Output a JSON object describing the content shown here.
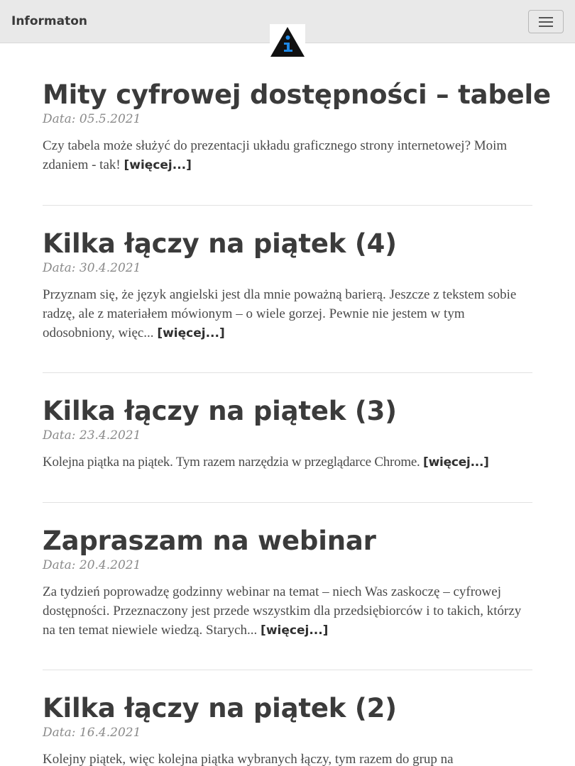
{
  "navbar": {
    "brand": "Informaton",
    "logo_icon": "info-triangle-logo",
    "menu_icon": "hamburger-menu-icon",
    "colors": {
      "background": "#e9e9e9",
      "logo_triangle": "#111111",
      "logo_i": "#1e88e5"
    }
  },
  "posts": [
    {
      "title": "Mity cyfrowej dostępności – tabele",
      "date_label": "Data:",
      "date": "05.5.2021",
      "excerpt": "Czy tabela może służyć do prezentacji układu graficznego strony internetowej? Moim zdaniem - tak!",
      "more": "[więcej...]"
    },
    {
      "title": "Kilka łączy na piątek (4)",
      "date_label": "Data:",
      "date": "30.4.2021",
      "excerpt": "Przyznam się, że język angielski jest dla mnie poważną barierą. Jeszcze z tekstem sobie radzę, ale z materiałem mówionym – o wiele gorzej. Pewnie nie jestem w tym odosobniony, więc...",
      "more": "[więcej...]"
    },
    {
      "title": "Kilka łączy na piątek (3)",
      "date_label": "Data:",
      "date": "23.4.2021",
      "excerpt": "Kolejna piątka na piątek. Tym razem narzędzia w przeglądarce Chrome.",
      "more": "[więcej...]"
    },
    {
      "title": "Zapraszam na webinar",
      "date_label": "Data:",
      "date": "20.4.2021",
      "excerpt": "Za tydzień poprowadzę godzinny webinar na temat – niech Was zaskoczę – cyfrowej dostępności. Przeznaczony jest przede wszystkim dla przedsiębiorców i to takich, którzy na ten temat niewiele wiedzą. Starych...",
      "more": "[więcej...]"
    },
    {
      "title": "Kilka łączy na piątek (2)",
      "date_label": "Data:",
      "date": "16.4.2021",
      "excerpt": "Kolejny piątek, więc kolejna piątka wybranych łączy, tym razem do grup na",
      "more": ""
    }
  ]
}
